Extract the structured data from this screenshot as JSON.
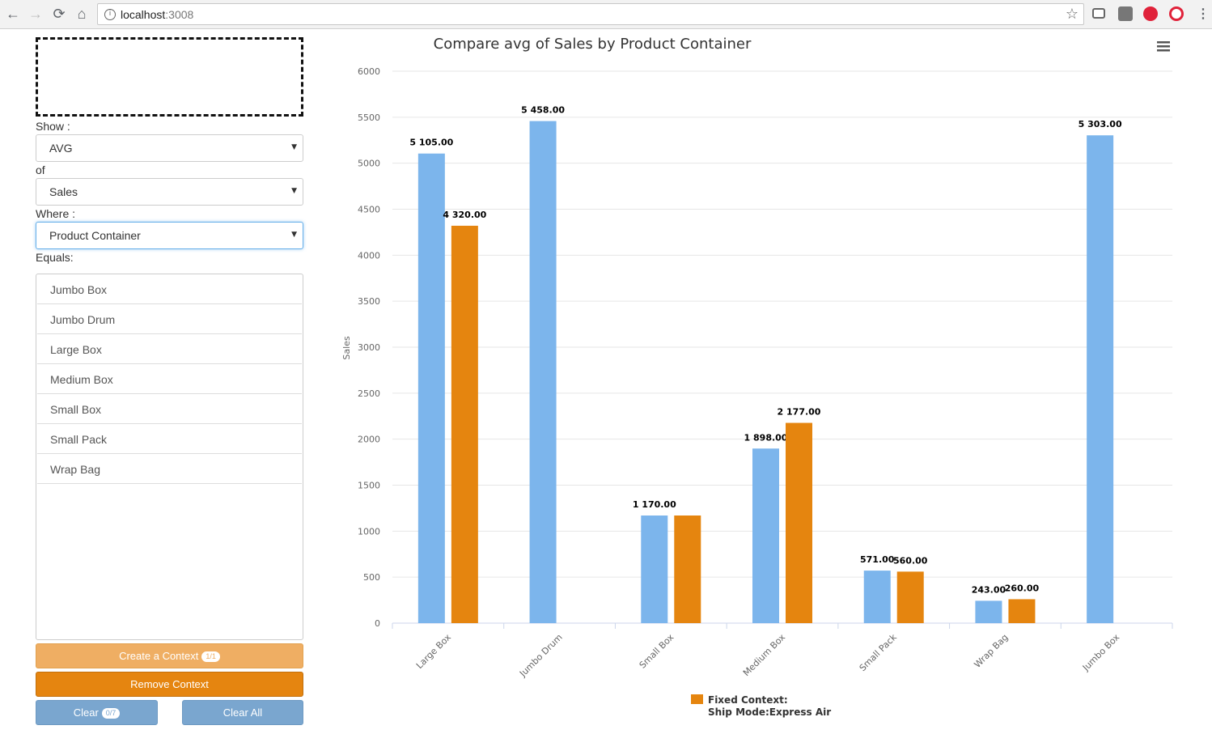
{
  "browser": {
    "url_host": "localhost",
    "url_port": ":3008",
    "info_icon": "i"
  },
  "sidebar": {
    "show_label": "Show :",
    "show_value": "AVG",
    "of_label": "of",
    "of_value": "Sales",
    "where_label": "Where :",
    "where_value": "Product Container",
    "equals_label": "Equals:",
    "items": [
      "Jumbo Box",
      "Jumbo Drum",
      "Large Box",
      "Medium Box",
      "Small Box",
      "Small Pack",
      "Wrap Bag"
    ],
    "create_label": "Create a Context",
    "create_badge": "1/1",
    "remove_label": "Remove Context",
    "clear_label": "Clear",
    "clear_badge": "0/7",
    "clear_all_label": "Clear All"
  },
  "chart_data": {
    "type": "bar",
    "title": "Compare avg of Sales by Product Container",
    "ylabel": "Sales",
    "xlabel": "",
    "ylim": [
      0,
      6000
    ],
    "yticks": [
      0,
      500,
      1000,
      1500,
      2000,
      2500,
      3000,
      3500,
      4000,
      4500,
      5000,
      5500,
      6000
    ],
    "categories": [
      "Large Box",
      "Jumbo Drum",
      "Small Box",
      "Medium Box",
      "Small Pack",
      "Wrap Bag",
      "Jumbo Box"
    ],
    "series": [
      {
        "values": [
          5105,
          5458,
          1170,
          1898,
          571,
          243,
          5303
        ],
        "labels": [
          "5 105.00",
          "5 458.00",
          "1 170.00",
          "1 898.00",
          "571.00",
          "243.00",
          "5 303.00"
        ],
        "color": "#7cb5ec"
      },
      {
        "name": "Fixed Context: Ship Mode:Express Air",
        "values": [
          4320,
          null,
          1170,
          2177,
          560,
          260,
          null
        ],
        "labels": [
          "4 320.00",
          "",
          "",
          "2 177.00",
          "560.00",
          "260.00",
          ""
        ],
        "color": "#e5850f"
      }
    ],
    "legend_line1": "Fixed Context:",
    "legend_line2": "Ship Mode:Express Air",
    "legend_position": "bottom-center",
    "grid": true
  },
  "colors": {
    "accent_orange": "#e58510",
    "light_orange": "#efae63",
    "blue_button": "#7aa6cf",
    "bar_blue": "#7cb5ec"
  }
}
